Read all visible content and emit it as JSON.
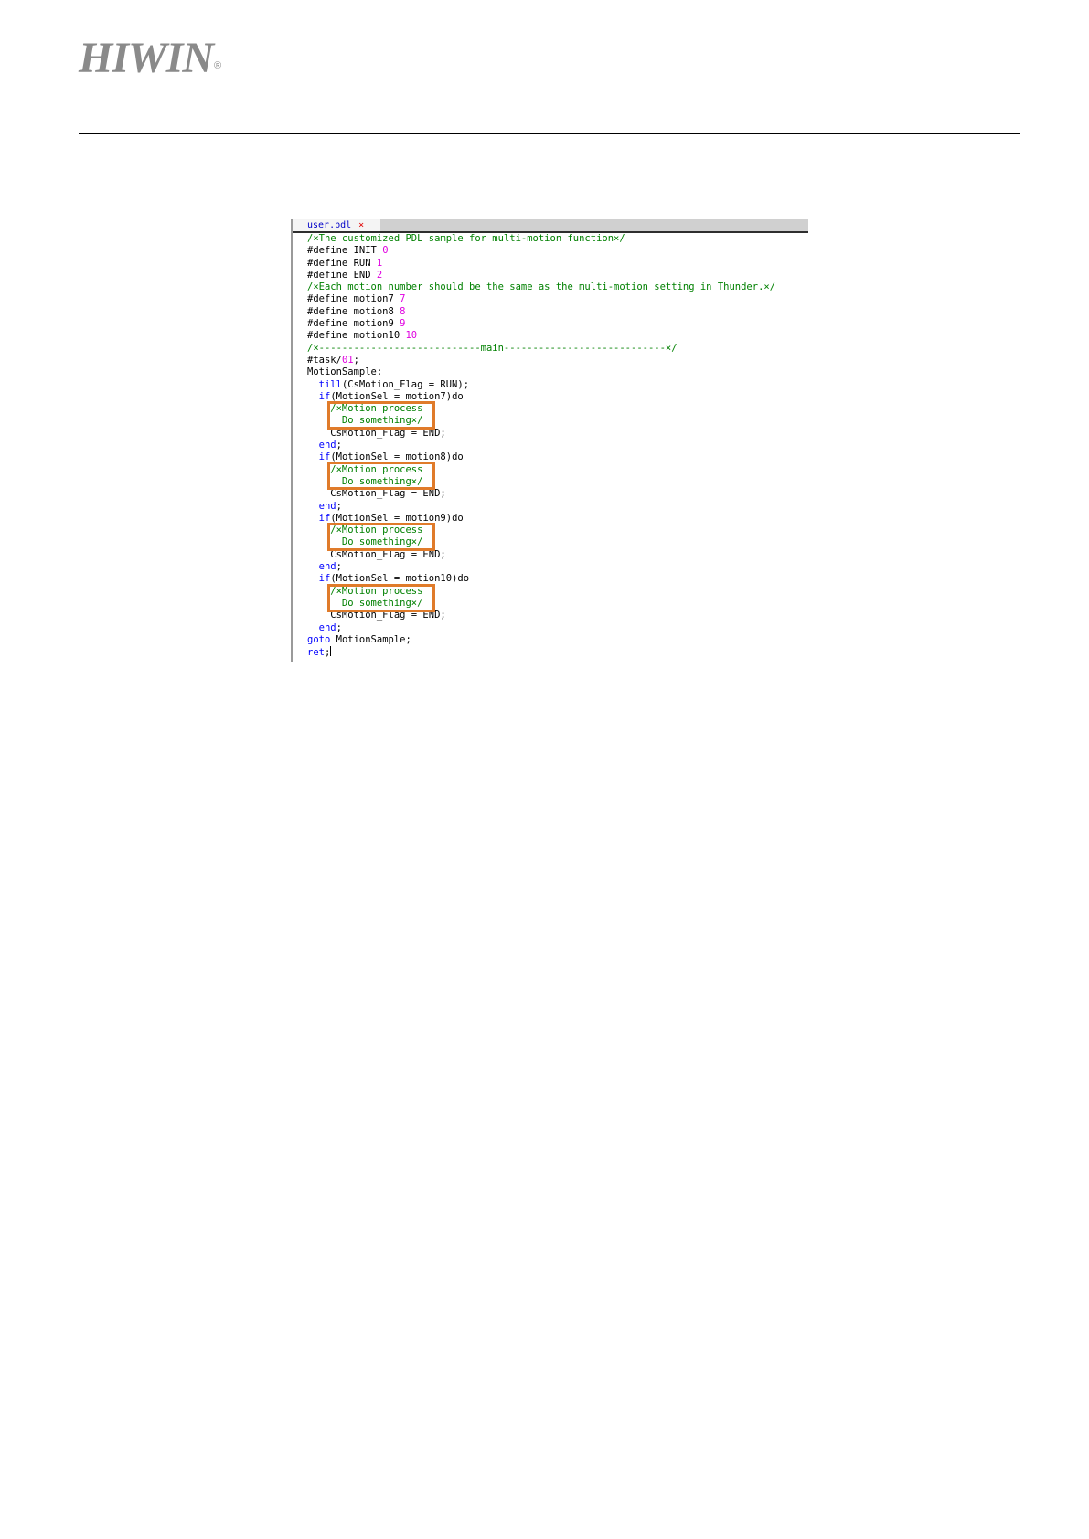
{
  "header": {
    "logo_text": "HIWIN",
    "logo_registered": "®"
  },
  "editor": {
    "tab_label": "user.pdl",
    "tab_close": "×",
    "lines": [
      [
        {
          "t": "/×The customized PDL sample for multi-motion function×/",
          "c": "cm"
        }
      ],
      [
        {
          "t": "#define INIT ",
          "c": ""
        },
        {
          "t": "0",
          "c": "num"
        }
      ],
      [
        {
          "t": "#define RUN ",
          "c": ""
        },
        {
          "t": "1",
          "c": "num"
        }
      ],
      [
        {
          "t": "#define END ",
          "c": ""
        },
        {
          "t": "2",
          "c": "num"
        }
      ],
      [
        {
          "t": "/×Each motion number should be the same as the multi-motion setting in Thunder.×/",
          "c": "cm"
        }
      ],
      [
        {
          "t": "#define motion7 ",
          "c": ""
        },
        {
          "t": "7",
          "c": "num"
        }
      ],
      [
        {
          "t": "#define motion8 ",
          "c": ""
        },
        {
          "t": "8",
          "c": "num"
        }
      ],
      [
        {
          "t": "#define motion9 ",
          "c": ""
        },
        {
          "t": "9",
          "c": "num"
        }
      ],
      [
        {
          "t": "#define motion10 ",
          "c": ""
        },
        {
          "t": "10",
          "c": "num"
        }
      ],
      [
        {
          "t": "/×----------------------------main----------------------------×/",
          "c": "cm"
        }
      ],
      [
        {
          "t": "#task/",
          "c": ""
        },
        {
          "t": "01",
          "c": "num"
        },
        {
          "t": ";",
          "c": ""
        }
      ],
      [
        {
          "t": "MotionSample:",
          "c": ""
        }
      ],
      [
        {
          "t": "  ",
          "c": ""
        },
        {
          "t": "till",
          "c": "kw"
        },
        {
          "t": "(CsMotion_Flag = RUN);",
          "c": ""
        }
      ],
      [
        {
          "t": "  ",
          "c": ""
        },
        {
          "t": "if",
          "c": "kw"
        },
        {
          "t": "(MotionSel = motion7)do",
          "c": ""
        }
      ],
      [
        {
          "t": "    /×Motion process",
          "c": "cm"
        }
      ],
      [
        {
          "t": "      Do something×/",
          "c": "cm"
        }
      ],
      [
        {
          "t": "    CsMotion_Flag = END;",
          "c": ""
        }
      ],
      [
        {
          "t": "  ",
          "c": ""
        },
        {
          "t": "end",
          "c": "kw"
        },
        {
          "t": ";",
          "c": ""
        }
      ],
      [
        {
          "t": "  ",
          "c": ""
        },
        {
          "t": "if",
          "c": "kw"
        },
        {
          "t": "(MotionSel = motion8)do",
          "c": ""
        }
      ],
      [
        {
          "t": "    /×Motion process",
          "c": "cm"
        }
      ],
      [
        {
          "t": "      Do something×/",
          "c": "cm"
        }
      ],
      [
        {
          "t": "    CsMotion_Flag = END;",
          "c": ""
        }
      ],
      [
        {
          "t": "  ",
          "c": ""
        },
        {
          "t": "end",
          "c": "kw"
        },
        {
          "t": ";",
          "c": ""
        }
      ],
      [
        {
          "t": "  ",
          "c": ""
        },
        {
          "t": "if",
          "c": "kw"
        },
        {
          "t": "(MotionSel = motion9)do",
          "c": ""
        }
      ],
      [
        {
          "t": "    /×Motion process",
          "c": "cm"
        }
      ],
      [
        {
          "t": "      Do something×/",
          "c": "cm"
        }
      ],
      [
        {
          "t": "    CsMotion_Flag = END;",
          "c": ""
        }
      ],
      [
        {
          "t": "  ",
          "c": ""
        },
        {
          "t": "end",
          "c": "kw"
        },
        {
          "t": ";",
          "c": ""
        }
      ],
      [
        {
          "t": "  ",
          "c": ""
        },
        {
          "t": "if",
          "c": "kw"
        },
        {
          "t": "(MotionSel = motion10)do",
          "c": ""
        }
      ],
      [
        {
          "t": "    /×Motion process",
          "c": "cm"
        }
      ],
      [
        {
          "t": "      Do something×/",
          "c": "cm"
        }
      ],
      [
        {
          "t": "    CsMotion_Flag = END;",
          "c": ""
        }
      ],
      [
        {
          "t": "  ",
          "c": ""
        },
        {
          "t": "end",
          "c": "kw"
        },
        {
          "t": ";",
          "c": ""
        }
      ],
      [
        {
          "t": "goto",
          "c": "kw"
        },
        {
          "t": " MotionSample;",
          "c": ""
        }
      ],
      [
        {
          "t": "ret",
          "c": "kw"
        },
        {
          "t": ";",
          "c": ""
        }
      ]
    ]
  },
  "colors": {
    "comment": "#008000",
    "keyword": "#0000ff",
    "number": "#e000e0",
    "highlight_box": "#e07b2a",
    "logo": "#8a8a8a"
  }
}
